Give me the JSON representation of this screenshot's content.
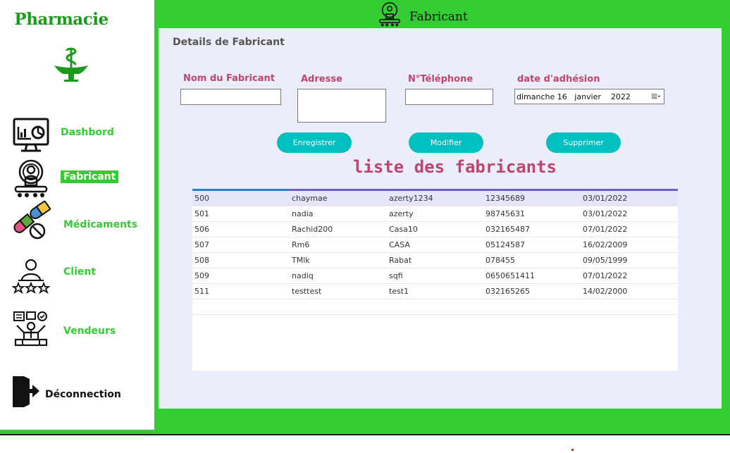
{
  "app": {
    "brand": "Pharmacie",
    "window_title": "Fabricant"
  },
  "sidebar": {
    "items": [
      {
        "label": "Dashbord",
        "icon": "dashboard-icon"
      },
      {
        "label": "Fabricant",
        "icon": "manufacturer-icon",
        "active": true
      },
      {
        "label": "Médicaments",
        "icon": "pills-icon"
      },
      {
        "label": "Client",
        "icon": "client-icon"
      },
      {
        "label": "Vendeurs",
        "icon": "sellers-icon"
      },
      {
        "label": "Déconnection",
        "icon": "logout-icon"
      }
    ]
  },
  "form": {
    "section_title": "Details de Fabricant",
    "labels": {
      "name": "Nom du Fabricant",
      "address": "Adresse",
      "phone": "N°Téléphone",
      "date": "date d'adhésion"
    },
    "values": {
      "name": "",
      "address": "",
      "phone": ""
    },
    "date": {
      "weekday": "dimanche",
      "day": "16",
      "month": "janvier",
      "year": "2022"
    },
    "buttons": {
      "save": "Enregistrer",
      "edit": "Modifier",
      "delete": "Supprimer"
    }
  },
  "list": {
    "title": "liste des fabricants",
    "rows": [
      [
        "500",
        "chaymae",
        "azerty1234",
        "12345689",
        "03/01/2022"
      ],
      [
        "501",
        "nadia",
        " azerty",
        "98745631",
        "03/01/2022"
      ],
      [
        "506",
        "Rachid200",
        "Casa10",
        "032165487",
        "07/01/2022"
      ],
      [
        "507",
        "Rm6",
        "CASA",
        "05124587",
        "16/02/2009"
      ],
      [
        "508",
        "TMlk",
        "Rabat",
        "078455",
        "09/05/1999"
      ],
      [
        "509",
        "nadiq",
        "sqfi",
        "0650651411",
        "07/01/2022"
      ],
      [
        "511",
        "testtest",
        "test1",
        "032165265",
        "14/02/2000"
      ]
    ],
    "selected_row": 0
  },
  "colors": {
    "sidebar_green": "#33cc33",
    "accent_pink": "#c0456e",
    "button_teal": "#00bfbf",
    "panel": "#ebedfa"
  }
}
